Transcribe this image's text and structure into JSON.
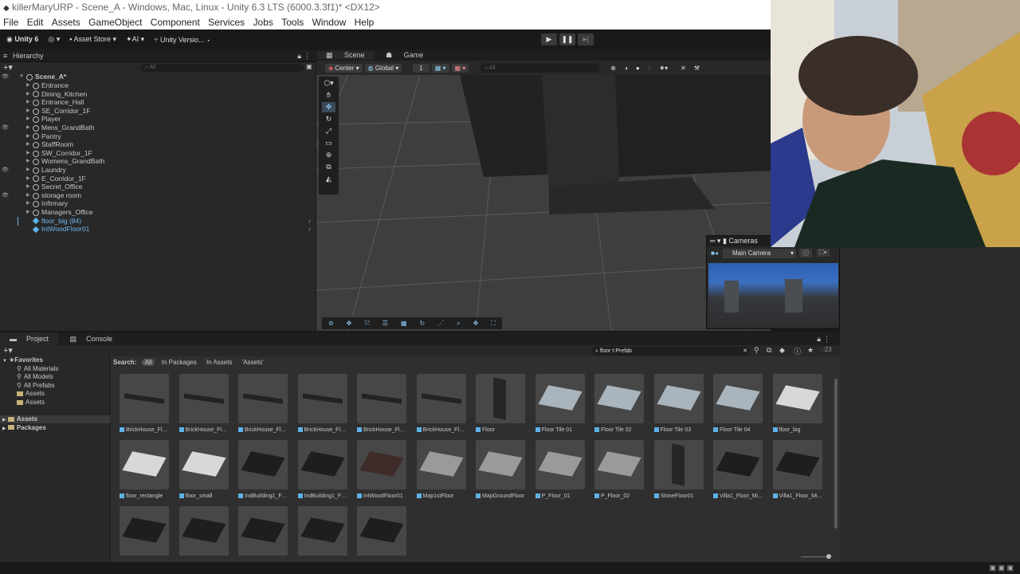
{
  "window": {
    "title": "killerMaryURP - Scene_A - Windows, Mac, Linux - Unity 6.3 LTS (6000.3.3f1)* <DX12>"
  },
  "menu": [
    "File",
    "Edit",
    "Assets",
    "GameObject",
    "Component",
    "Services",
    "Jobs",
    "Tools",
    "Window",
    "Help"
  ],
  "toolbar": {
    "account": "Unity 6",
    "asset_store": "Asset Store",
    "ai": "AI",
    "version_control": "Unity Versio..."
  },
  "hierarchy": {
    "tab": "Hierarchy",
    "search_placeholder": "All",
    "scene": "Scene_A*",
    "items": [
      "Entrance",
      "Dining_Kitchen",
      "Entrance_Hall",
      "SE_Corridor_1F",
      "Player",
      "Mens_GrandBath",
      "Pantry",
      "StaffRoom",
      "SW_Corridor_1F",
      "Womens_GrandBath",
      "Laundry",
      "E_Corridor_1F",
      "Secret_Office",
      "storage room",
      "Infirmary",
      "Managers_Office"
    ],
    "prefab_items": [
      "floor_big (84)",
      "IntWoodFloor01"
    ]
  },
  "scene": {
    "tabs": [
      "Scene",
      "Game"
    ],
    "pivot": "Center",
    "space": "Global",
    "snap_value": "1",
    "search_placeholder": "All"
  },
  "cameras": {
    "title": "Cameras",
    "selected": "Main Camera"
  },
  "project": {
    "tabs": [
      "Project",
      "Console"
    ],
    "search_query": "floor t:Prefab",
    "result_count": "23",
    "search_label": "Search:",
    "scopes": [
      "All",
      "In Packages",
      "In Assets",
      "'Assets'"
    ],
    "favorites_label": "Favorites",
    "favorites": [
      "All Materials",
      "All Models",
      "All Prefabs",
      "Assets",
      "Assets"
    ],
    "roots": [
      "Assets",
      "Packages"
    ],
    "assets": [
      "BrickHouse_Flo...",
      "BrickHouse_Flo...",
      "BrickHouse_Flo...",
      "BrickHouse_Flo...",
      "BrickHouse_Flo...",
      "BrickHouse_Flo...",
      "Floor",
      "Floor Tile 01",
      "Floor Tile 02",
      "Floor Tile 03",
      "Floor Tile 04",
      "floor_big",
      "floor_rectangle",
      "floor_small",
      "IndBuilding1_Fl...",
      "IndBuilding1_Fl...",
      "IntWoodFloor01",
      "Map1stFloor",
      "MapGroundFloor",
      "P_Floor_01",
      "P_Floor_02",
      "StoneFloor01",
      "Villa1_Floor_Mi...",
      "Villa1_Floor_Mi...",
      "",
      "",
      "",
      "",
      ""
    ]
  }
}
